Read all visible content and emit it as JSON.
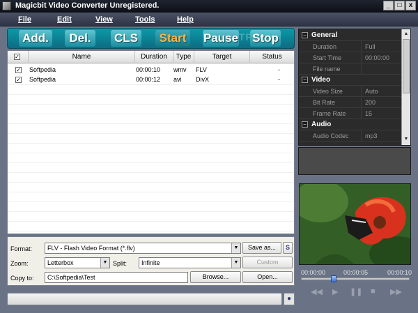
{
  "window": {
    "title": "Magicbit Video Converter Unregistered.",
    "min": "_",
    "max": "□",
    "close": "x"
  },
  "menu": [
    "File",
    "Edit",
    "View",
    "Tools",
    "Help"
  ],
  "toolbar": {
    "add": "Add.",
    "del": "Del.",
    "cls": "CLS",
    "start": "Start",
    "pause": "Pause",
    "stop": "Stop",
    "watermark": "SOFTPEDIA"
  },
  "list": {
    "columns": [
      "Name",
      "Duration",
      "Type",
      "Target",
      "Status"
    ],
    "rows": [
      {
        "name": "Softpedia",
        "duration": "00:00:10",
        "type": "wmv",
        "target": "FLV",
        "status": "-"
      },
      {
        "name": "Softpedia",
        "duration": "00:00:12",
        "type": "avi",
        "target": "DivX",
        "status": "-"
      }
    ]
  },
  "controls": {
    "format_label": "Format:",
    "format_value": "FLV - Flash Video Format  (*.flv)",
    "save_as": "Save as...",
    "s_btn": "S",
    "zoom_label": "Zoom:",
    "zoom_value": "Letterbox",
    "split_label": "Split:",
    "split_value": "Infinite",
    "custom": "Custom",
    "copyto_label": "Copy to:",
    "copyto_value": "C:\\Softpedia\\Test",
    "browse": "Browse...",
    "open": "Open..."
  },
  "props": {
    "cat_general": "General",
    "duration_k": "Duration",
    "duration_v": "Full",
    "start_k": "Start Time",
    "start_v": "00:00:00",
    "file_k": "File name",
    "file_v": "",
    "cat_video": "Video",
    "vsize_k": "Video Size",
    "vsize_v": "Auto",
    "bitrate_k": "Bit Rate",
    "bitrate_v": "200",
    "frame_k": "Frame Rate",
    "frame_v": "15",
    "cat_audio": "Audio",
    "acodec_k": "Audio Codec",
    "acodec_v": "mp3"
  },
  "player": {
    "t0": "00:00:00",
    "t1": "00:00:05",
    "t2": "00:00:10",
    "position": 0.3
  }
}
